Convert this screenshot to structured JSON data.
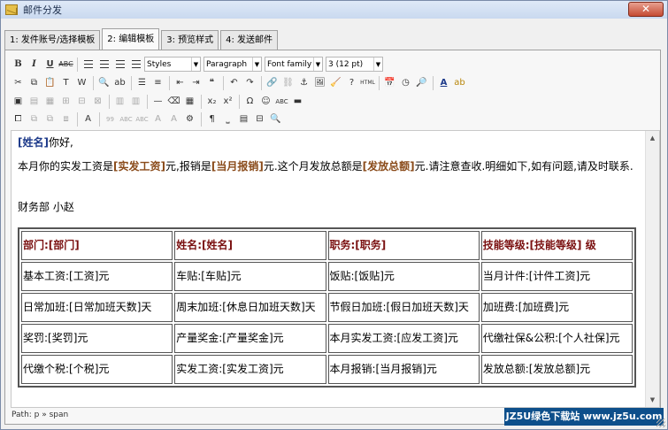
{
  "window": {
    "title": "邮件分发",
    "close_label": "✕"
  },
  "tabs": [
    {
      "label": "1: 发件账号/选择模板"
    },
    {
      "label": "2: 编辑模板"
    },
    {
      "label": "3: 预览样式"
    },
    {
      "label": "4: 发送邮件"
    }
  ],
  "toolbar": {
    "styles_value": "Styles",
    "format_value": "Paragraph",
    "font_value": "Font family",
    "size_value": "3 (12 pt)"
  },
  "editor": {
    "greeting_field": "[姓名]",
    "greeting_text": "你好,",
    "p2_a": "本月你的实发工资是",
    "p2_f1": "[实发工资]",
    "p2_b": "元,报销是",
    "p2_f2": "[当月报销]",
    "p2_c": "元.这个月发放总额是",
    "p2_f3": "[发放总额]",
    "p2_d": "元.请注意查收.明细如下,如有问题,请及时联系.",
    "signature": "财务部 小赵",
    "table": {
      "rows": [
        [
          "部门:[部门]",
          "姓名:[姓名]",
          "职务:[职务]",
          "技能等级:[技能等级] 级"
        ],
        [
          "基本工资:[工资]元",
          "车贴:[车贴]元",
          "饭贴:[饭贴]元",
          "当月计件:[计件工资]元"
        ],
        [
          "日常加班:[日常加班天数]天",
          "周末加班:[休息日加班天数]天",
          "节假日加班:[假日加班天数]天",
          "加班费:[加班费]元"
        ],
        [
          "奖罚:[奖罚]元",
          "产量奖金:[产量奖金]元",
          "本月实发工资:[应发工资]元",
          "代缴社保&公积:[个人社保]元"
        ],
        [
          "代缴个税:[个税]元",
          "实发工资:[实发工资]元",
          "本月报销:[当月报销]元",
          "发放总额:[发放总额]元"
        ]
      ]
    }
  },
  "status": {
    "path": "Path: p » span"
  },
  "watermark": {
    "text": "JZ5U绿色下载站 www.jz5u.com"
  }
}
